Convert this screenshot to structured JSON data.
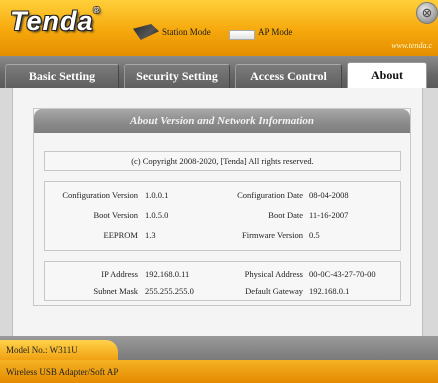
{
  "header": {
    "logo": "Tenda",
    "logo_tm": "®",
    "station_mode": "Station Mode",
    "ap_mode": "AP Mode",
    "site": "www.tenda.c",
    "close_glyph": "⊗"
  },
  "tabs": [
    {
      "label": "Basic Setting"
    },
    {
      "label": "Security Setting"
    },
    {
      "label": "Access Control"
    },
    {
      "label": "About"
    }
  ],
  "panel": {
    "title": "About Version and Network Information",
    "copyright": "(c) Copyright 2008-2020, [Tenda] All rights reserved.",
    "version": {
      "config_version_label": "Configuration Version",
      "config_version": "1.0.0.1",
      "config_date_label": "Configuration Date",
      "config_date": "08-04-2008",
      "boot_version_label": "Boot Version",
      "boot_version": "1.0.5.0",
      "boot_date_label": "Boot Date",
      "boot_date": "11-16-2007",
      "eeprom_label": "EEPROM",
      "eeprom": "1.3",
      "firmware_label": "Firmware Version",
      "firmware": "0.5"
    },
    "network": {
      "ip_label": "IP Address",
      "ip": "192.168.0.11",
      "mac_label": "Physical Address",
      "mac": "00-0C-43-27-70-00",
      "mask_label": "Subnet Mask",
      "mask": "255.255.255.0",
      "gateway_label": "Default Gateway",
      "gateway": "192.168.0.1"
    }
  },
  "footer": {
    "model": "Model No.: W311U",
    "description": "Wireless USB Adapter/Soft AP"
  }
}
